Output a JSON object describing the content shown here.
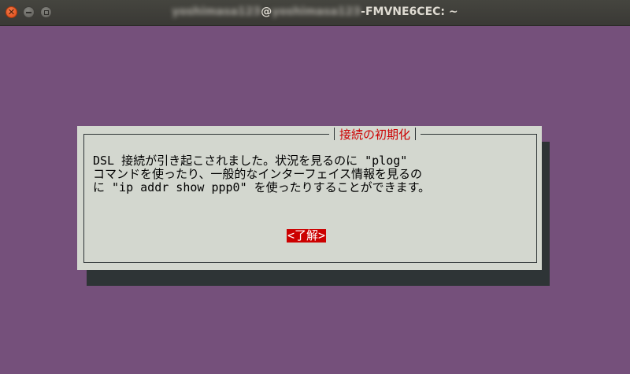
{
  "window": {
    "title_user_blurred": "yoshimasa123",
    "title_at": "@",
    "title_host_blurred": "yoshimasa123",
    "title_suffix": "-FMVNE6CEC: ~"
  },
  "dialog": {
    "title": "接続の初期化",
    "message_lines": [
      "DSL 接続が引き起こされました。状況を見るのに \"plog\"",
      "コマンドを使ったり、一般的なインターフェイス情報を見るの",
      "に \"ip addr show ppp0\" を使ったりすることができます。"
    ],
    "ok_label": "<了解>"
  },
  "colors": {
    "terminal_bg": "#75507b",
    "dialog_bg": "#d3d7cf",
    "accent_red": "#cc0000",
    "shadow": "#2e3436"
  }
}
